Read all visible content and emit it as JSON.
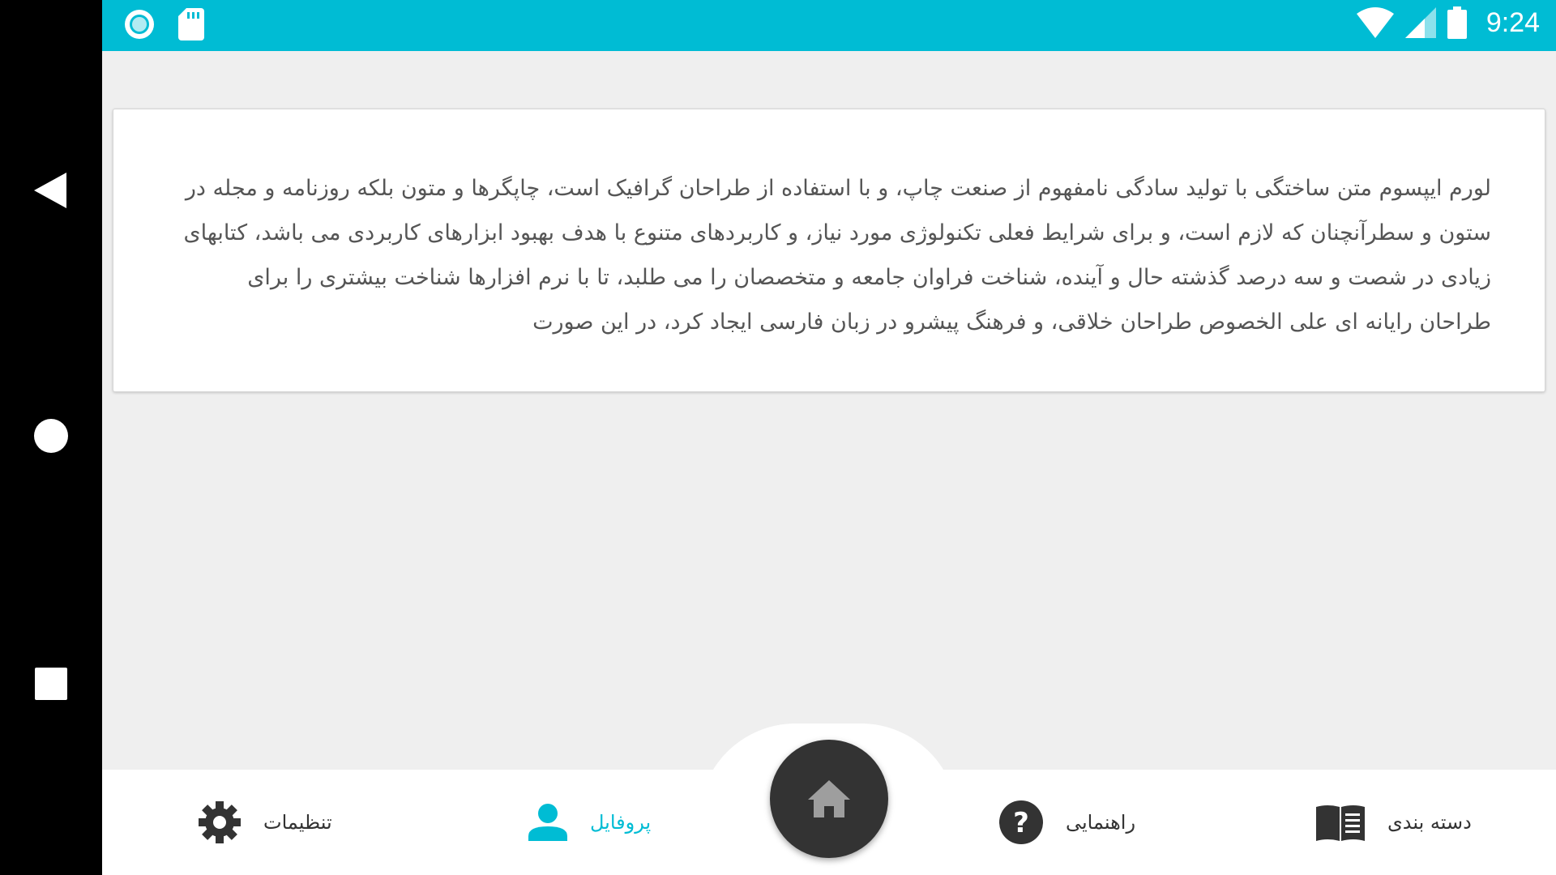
{
  "status_bar": {
    "time": "9:24",
    "left_icons": [
      "sync-circle-icon",
      "sd-card-icon"
    ],
    "right_icons": [
      "wifi-icon",
      "signal-icon",
      "battery-icon"
    ],
    "color": "#00bcd4"
  },
  "content": {
    "paragraph": "لورم ایپسوم متن ساختگی با تولید سادگی نامفهوم از صنعت چاپ، و با استفاده از طراحان گرافیک است، چاپگرها و متون بلکه روزنامه و مجله در ستون و سطرآنچنان که لازم است، و برای شرایط فعلی تکنولوژی مورد نیاز، و کاربردهای متنوع با هدف بهبود ابزارهای کاربردی می باشد، کتابهای زیادی در شصت و سه درصد گذشته حال و آینده، شناخت فراوان جامعه و متخصصان را می طلبد، تا با نرم افزارها شناخت بیشتری را برای طراحان رایانه ای علی الخصوص طراحان خلاقی، و فرهنگ پیشرو در زبان فارسی ایجاد کرد، در این صورت"
  },
  "bottom_nav": {
    "settings": {
      "label": "تنظیمات",
      "icon": "gear-icon"
    },
    "profile": {
      "label": "پروفایل",
      "icon": "person-icon",
      "active": true
    },
    "home": {
      "icon": "home-icon"
    },
    "guide": {
      "label": "راهنمایی",
      "icon": "help-icon"
    },
    "category": {
      "label": "دسته بندی",
      "icon": "book-icon"
    },
    "accent": "#00bcd4"
  },
  "system_nav": {
    "icons": [
      "back-icon",
      "home-circle-icon",
      "recents-icon"
    ]
  }
}
